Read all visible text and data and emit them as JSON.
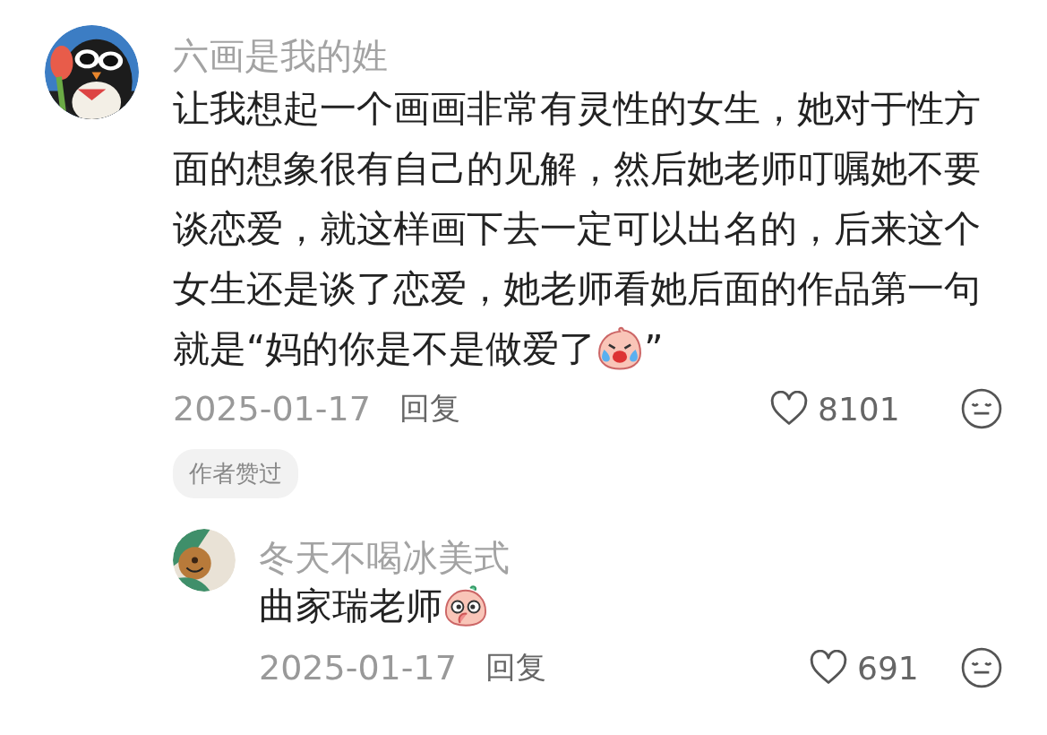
{
  "comments": [
    {
      "kind": "top",
      "name": "六画是我的姓",
      "text": "让我想起一个画画非常有灵性的女生，她对于性方面的想象很有自己的见解，然后她老师叮嘱她不要谈恋爱，就这样画下去一定可以出名的，后来这个女生还是谈了恋爱，她老师看她后面的作品第一句",
      "last_line": "就是“妈的你是不是做爱了",
      "emoji": {
        "kind": "crying-laugh"
      },
      "text_after": "”",
      "date": "2025-01-17",
      "reply": "回复",
      "likes": "8101",
      "tag": "作者赞过"
    },
    {
      "kind": "reply",
      "name": "冬天不喝冰美式",
      "last_line": "曲家瑞老师",
      "emoji": {
        "kind": "shy"
      },
      "date": "2025-01-17",
      "reply": "回复",
      "likes": "691"
    }
  ]
}
